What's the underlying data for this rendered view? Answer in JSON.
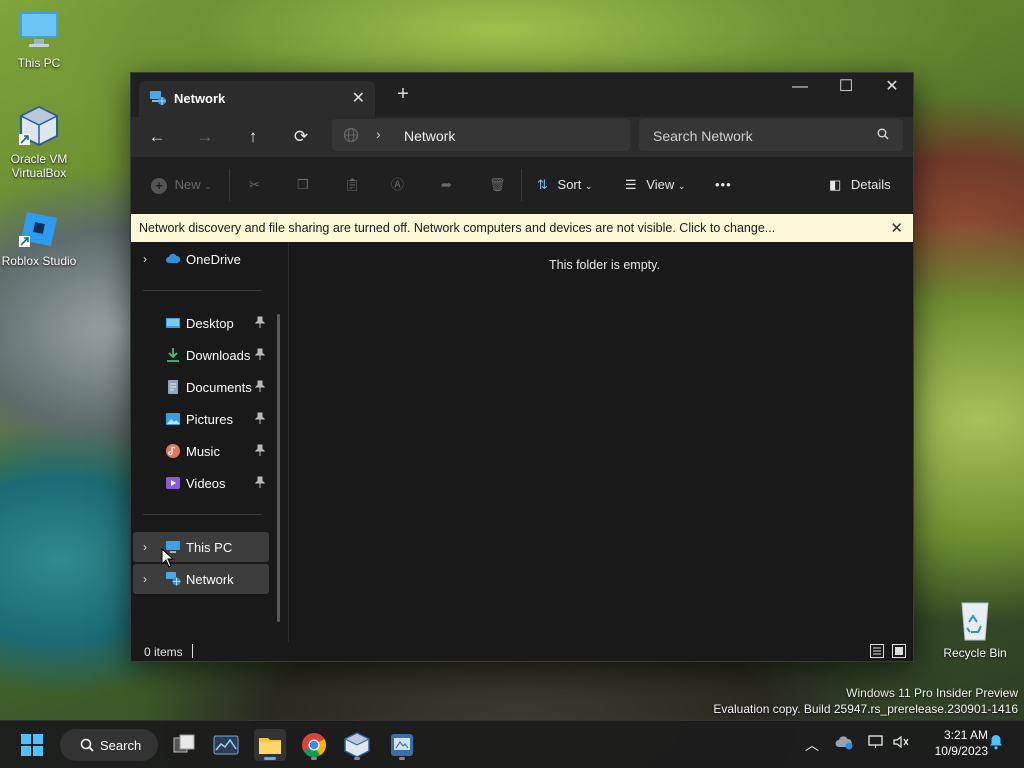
{
  "desktop": {
    "icons": [
      {
        "label": "This PC"
      },
      {
        "label": "Oracle VM VirtualBox"
      },
      {
        "label": "Roblox Studio"
      },
      {
        "label": "Recycle Bin"
      }
    ]
  },
  "window": {
    "tab_title": "Network",
    "new_tab_symbol": "+",
    "controls": {
      "minimize": "—",
      "maximize": "☐",
      "close": "✕"
    },
    "address": {
      "crumb": "Network"
    },
    "search": {
      "placeholder": "Search Network"
    },
    "toolbar": {
      "new_label": "New",
      "sort_label": "Sort",
      "view_label": "View",
      "more_label": "•••",
      "details_label": "Details"
    },
    "infobar": {
      "message": "Network discovery and file sharing are turned off. Network computers and devices are not visible. Click to change...",
      "close": "✕"
    },
    "sidebar": {
      "onedrive": "OneDrive",
      "quick_access": [
        {
          "label": "Desktop",
          "icon": "desktop-icon"
        },
        {
          "label": "Downloads",
          "icon": "downloads-icon"
        },
        {
          "label": "Documents",
          "icon": "documents-icon"
        },
        {
          "label": "Pictures",
          "icon": "pictures-icon"
        },
        {
          "label": "Music",
          "icon": "music-icon"
        },
        {
          "label": "Videos",
          "icon": "videos-icon"
        }
      ],
      "this_pc": "This PC",
      "network": "Network"
    },
    "main": {
      "empty_text": "This folder is empty."
    },
    "status": {
      "item_count": "0 items"
    }
  },
  "watermark": {
    "line1": "Windows 11 Pro Insider Preview",
    "line2": "Evaluation copy. Build 25947.rs_prerelease.230901-1416"
  },
  "taskbar": {
    "search_label": "Search",
    "time": "3:21 AM",
    "date": "10/9/2023"
  },
  "colors": {
    "accent": "#5fb2f2",
    "infobar_bg": "#fdf9d8",
    "window_bg": "#191919"
  }
}
